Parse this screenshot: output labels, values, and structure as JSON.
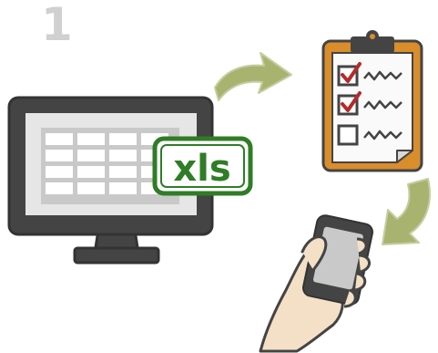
{
  "step": {
    "number": "1"
  },
  "badge": {
    "text": "xls"
  },
  "icons": {
    "monitor": "desktop-monitor-icon",
    "spreadsheet": "spreadsheet-icon",
    "badge": "xls-file-badge",
    "clipboard": "checklist-clipboard-icon",
    "phone": "smartphone-in-hand-icon",
    "arrow_1": "curved-arrow-right-icon",
    "arrow_2": "curved-arrow-down-left-icon"
  },
  "colors": {
    "step_number": "#d0d0d0",
    "monitor_frame": "#444444",
    "monitor_screen": "#c9c9c9",
    "monitor_bezel": "#e6e6e6",
    "spreadsheet_cell": "#ffffff",
    "badge_green": "#2f7d27",
    "clipboard_board": "#d98d2b",
    "clipboard_paper": "#fafafa",
    "check_red": "#b52a2a",
    "arrow_green": "#a8b36f",
    "hand_skin": "#f3e0c6",
    "phone_body": "#444444",
    "phone_screen": "#c9c9c9"
  }
}
